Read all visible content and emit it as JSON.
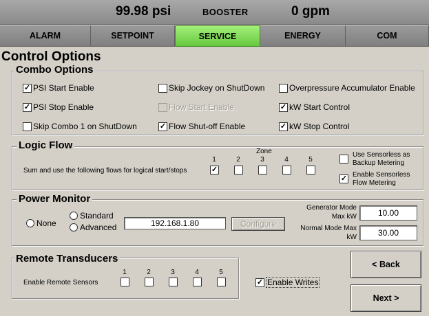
{
  "topbar": {
    "pressure": "99.98 psi",
    "mode": "BOOSTER",
    "flow": "0 gpm"
  },
  "tabs": [
    {
      "label": "ALARM"
    },
    {
      "label": "SETPOINT"
    },
    {
      "label": "SERVICE",
      "active": true
    },
    {
      "label": "ENERGY"
    },
    {
      "label": "COM"
    }
  ],
  "page_title": "Control Options",
  "combo": {
    "title": "Combo Options",
    "psi_start": {
      "label": "PSI Start Enable",
      "checked": true
    },
    "psi_stop": {
      "label": "PSI Stop Enable",
      "checked": true
    },
    "skip_combo1": {
      "label": "Skip Combo 1 on ShutDown",
      "checked": false
    },
    "skip_jockey": {
      "label": "Skip Jockey on ShutDown",
      "checked": false
    },
    "flow_start": {
      "label": "Flow Start Enable",
      "checked": false,
      "disabled": true
    },
    "flow_shutoff": {
      "label": "Flow Shut-off Enable",
      "checked": true
    },
    "overpressure": {
      "label": "Overpressure Accumulator Enable",
      "checked": false
    },
    "kw_start": {
      "label": "kW Start Control",
      "checked": true
    },
    "kw_stop": {
      "label": "kW Stop Control",
      "checked": true
    }
  },
  "logic": {
    "title": "Logic Flow",
    "zone_label": "Zone",
    "sum_label": "Sum and use the following flows for logical start/stops",
    "zones": [
      {
        "n": "1",
        "checked": true
      },
      {
        "n": "2",
        "checked": false
      },
      {
        "n": "3",
        "checked": false
      },
      {
        "n": "4",
        "checked": false
      },
      {
        "n": "5",
        "checked": false
      }
    ],
    "sensorless_backup": {
      "line1": "Use Sensorless as",
      "line2": "Backup Metering",
      "checked": false
    },
    "sensorless_enable": {
      "line1": "Enable Sensorless",
      "line2": "Flow Metering",
      "checked": true
    }
  },
  "power": {
    "title": "Power Monitor",
    "none_label": "None",
    "standard_label": "Standard",
    "advanced_label": "Advanced",
    "ip": "192.168.1.80",
    "configure_label": "Configure",
    "gen_label_1": "Generator Mode",
    "gen_label_2": "Max kW",
    "gen_value": "10.00",
    "normal_label_1": "Normal Mode Max",
    "normal_label_2": "kW",
    "normal_value": "30.00"
  },
  "remote": {
    "title": "Remote Transducers",
    "enable_label": "Enable Remote Sensors",
    "sensors": [
      {
        "n": "1",
        "checked": false
      },
      {
        "n": "2",
        "checked": false
      },
      {
        "n": "3",
        "checked": false
      },
      {
        "n": "4",
        "checked": false
      },
      {
        "n": "5",
        "checked": false
      }
    ],
    "enable_writes": {
      "label": "Enable Writes",
      "checked": true
    }
  },
  "nav": {
    "back_label": "< Back",
    "next_label": "Next >"
  }
}
